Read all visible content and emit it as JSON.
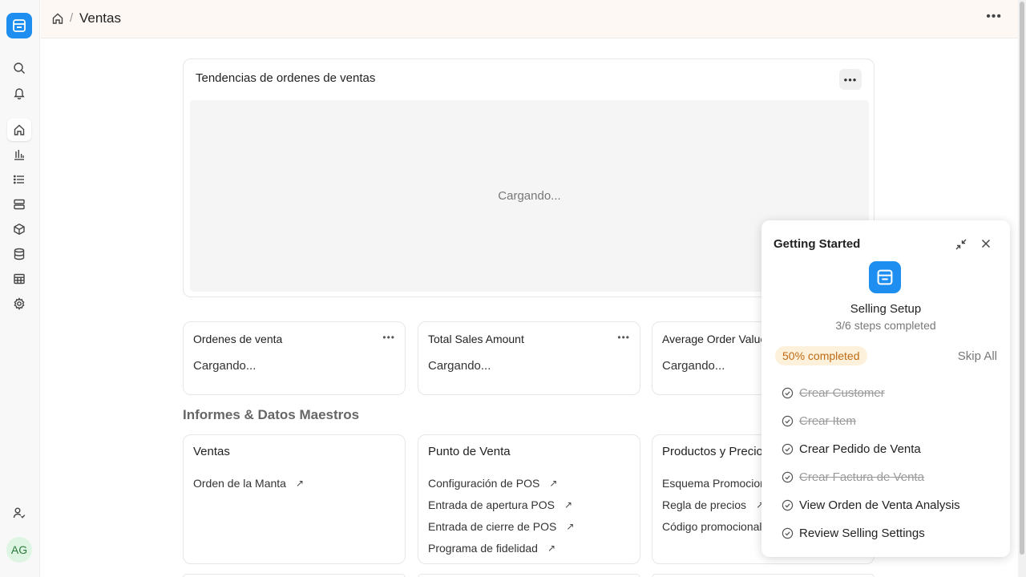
{
  "header": {
    "title": "Ventas"
  },
  "chart_card": {
    "title": "Tendencias de ordenes de ventas",
    "loading": "Cargando..."
  },
  "number_cards": [
    {
      "title": "Ordenes de venta",
      "value": "Cargando..."
    },
    {
      "title": "Total Sales Amount",
      "value": "Cargando..."
    },
    {
      "title": "Average Order Value",
      "value": "Cargando..."
    }
  ],
  "section_title": "Informes & Datos Maestros",
  "link_cards": [
    {
      "title": "Ventas",
      "items": [
        "Orden de la Manta"
      ]
    },
    {
      "title": "Punto de Venta",
      "items": [
        "Configuración de POS",
        "Entrada de apertura POS",
        "Entrada de cierre de POS",
        "Programa de fidelidad"
      ]
    },
    {
      "title": "Productos y Precios",
      "items": [
        "Esquema Promocional",
        "Regla de precios",
        "Código promocional"
      ]
    }
  ],
  "user": {
    "initials": "AG"
  },
  "getting_started": {
    "title": "Getting Started",
    "setup_title": "Selling Setup",
    "steps_completed": "3/6 steps completed",
    "progress_percent": 50,
    "progress_label": "50% completed",
    "skip_label": "Skip All",
    "steps": [
      {
        "label": "Crear Customer",
        "done": true
      },
      {
        "label": "Crear Item",
        "done": true
      },
      {
        "label": "Crear Pedido de Venta",
        "done": false
      },
      {
        "label": "Crear Factura de Venta",
        "done": true
      },
      {
        "label": "View Orden de Venta Analysis",
        "done": false
      },
      {
        "label": "Review Selling Settings",
        "done": false
      }
    ]
  },
  "colors": {
    "accent": "#1e8ef0",
    "badge_bg": "#fdf1dc",
    "badge_text": "#c06a12",
    "header_bg": "#fdf8f4"
  }
}
